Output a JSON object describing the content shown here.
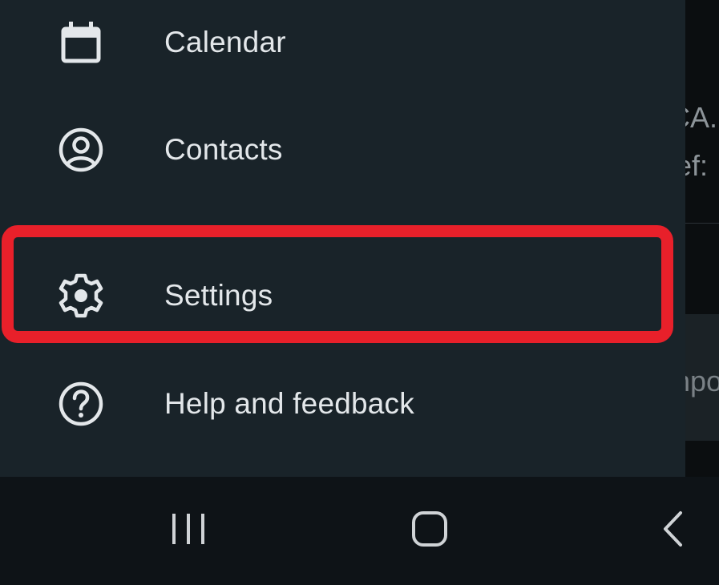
{
  "drawer": {
    "items": [
      {
        "label": "Calendar",
        "icon": "calendar-icon"
      },
      {
        "label": "Contacts",
        "icon": "account-circle-icon"
      },
      {
        "label": "Settings",
        "icon": "gear-icon",
        "highlighted": true
      },
      {
        "label": "Help and feedback",
        "icon": "help-circle-icon"
      }
    ]
  },
  "background": {
    "fragments": [
      "CA.",
      "ief:",
      "npo"
    ]
  },
  "system_nav": {
    "buttons": [
      "recents-icon",
      "home-icon",
      "back-icon"
    ]
  },
  "colors": {
    "drawer_bg": "#192329",
    "text": "#e3e7ea",
    "highlight": "#e8202a",
    "nav_bar_bg": "#0e1317"
  }
}
